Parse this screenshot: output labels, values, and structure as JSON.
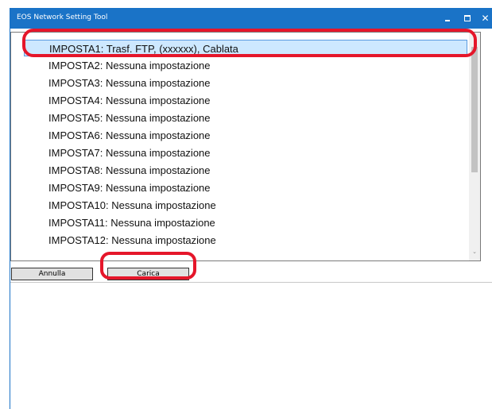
{
  "window": {
    "title": "EOS Network Setting Tool",
    "minimize_icon": "minimize-icon",
    "maximize_icon": "maximize-icon",
    "close_icon": "close-icon",
    "close_glyph": "✕"
  },
  "list": {
    "items": [
      {
        "label": "IMPOSTA1: Trasf. FTP, (xxxxxx), Cablata",
        "selected": true
      },
      {
        "label": "IMPOSTA2: Nessuna impostazione",
        "selected": false
      },
      {
        "label": "IMPOSTA3: Nessuna impostazione",
        "selected": false
      },
      {
        "label": "IMPOSTA4: Nessuna impostazione",
        "selected": false
      },
      {
        "label": "IMPOSTA5: Nessuna impostazione",
        "selected": false
      },
      {
        "label": "IMPOSTA6: Nessuna impostazione",
        "selected": false
      },
      {
        "label": "IMPOSTA7: Nessuna impostazione",
        "selected": false
      },
      {
        "label": "IMPOSTA8: Nessuna impostazione",
        "selected": false
      },
      {
        "label": "IMPOSTA9: Nessuna impostazione",
        "selected": false
      },
      {
        "label": "IMPOSTA10: Nessuna impostazione",
        "selected": false
      },
      {
        "label": "IMPOSTA11: Nessuna impostazione",
        "selected": false
      },
      {
        "label": "IMPOSTA12: Nessuna impostazione",
        "selected": false
      }
    ]
  },
  "buttons": {
    "cancel_label": "Annulla",
    "load_label": "Carica"
  },
  "colors": {
    "titlebar": "#1a73c7",
    "highlight": "#e5162a",
    "selection": "#cde8ff"
  }
}
